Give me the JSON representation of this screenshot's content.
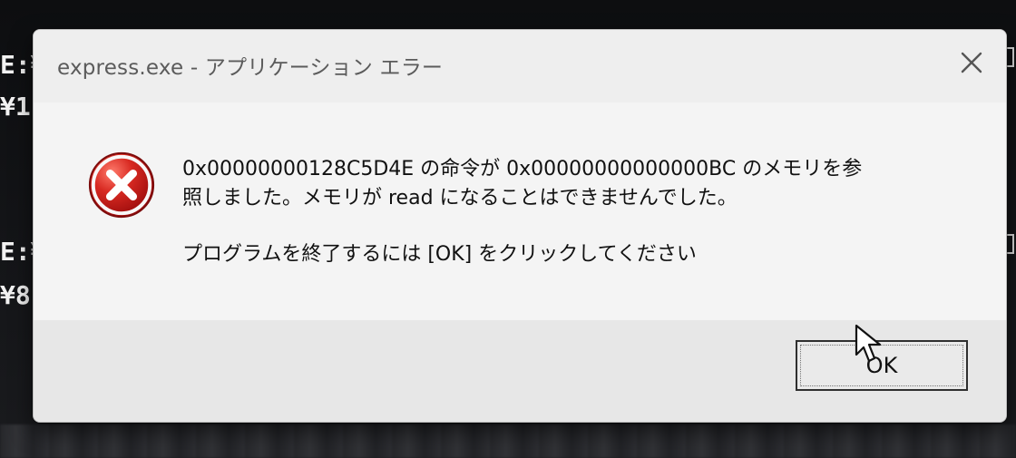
{
  "background": {
    "console_fragments": [
      {
        "text": "E:¥"
      },
      {
        "text": "¥1"
      },
      {
        "text": "E:¥"
      },
      {
        "text": "¥8"
      }
    ]
  },
  "dialog": {
    "title": "express.exe - アプリケーション エラー",
    "close_icon": "close-icon",
    "error_icon": "error-x-icon",
    "message": {
      "line1": "0x00000000128C5D4E の命令が 0x00000000000000BC のメモリを参",
      "line2": "照しました。メモリが read になることはできませんでした。",
      "line3": "プログラムを終了するには [OK] をクリックしてください"
    },
    "ok_button": {
      "label": "OK"
    }
  },
  "colors": {
    "dialog_bg": "#f3f3f3",
    "footer_bg": "#e7e7e7",
    "error_red": "#c71a1a",
    "title_text": "#5b5b5b",
    "button_border": "#2f2f2f"
  }
}
